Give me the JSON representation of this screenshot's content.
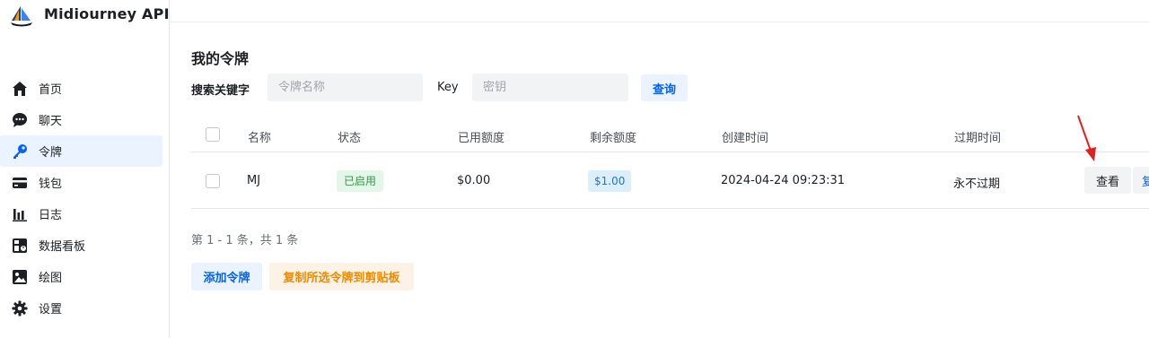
{
  "app": {
    "title": "Midiourney API"
  },
  "sidebar": {
    "items": [
      {
        "label": "首页",
        "icon": "home-icon"
      },
      {
        "label": "聊天",
        "icon": "chat-icon"
      },
      {
        "label": "令牌",
        "icon": "key-icon",
        "active": true
      },
      {
        "label": "钱包",
        "icon": "wallet-icon"
      },
      {
        "label": "日志",
        "icon": "bar-chart-icon"
      },
      {
        "label": "数据看板",
        "icon": "dashboard-icon"
      },
      {
        "label": "绘图",
        "icon": "image-icon"
      },
      {
        "label": "设置",
        "icon": "gear-icon"
      }
    ]
  },
  "page": {
    "title": "我的令牌"
  },
  "search": {
    "label": "搜索关键字",
    "name_placeholder": "令牌名称",
    "key_label": "Key",
    "key_placeholder": "密钥",
    "query_button": "查询"
  },
  "table": {
    "columns": [
      "名称",
      "状态",
      "已用额度",
      "剩余额度",
      "创建时间",
      "过期时间"
    ],
    "rows": [
      {
        "name": "MJ",
        "status": "已启用",
        "used": "$0.00",
        "remaining": "$1.00",
        "created": "2024-04-24 09:23:31",
        "expires": "永不过期",
        "view_button": "查看",
        "copy_button": "复"
      }
    ]
  },
  "pagination": {
    "info": "第 1 - 1 条，共 1 条"
  },
  "actions": {
    "add": "添加令牌",
    "copy_selected": "复制所选令牌到剪贴板"
  },
  "colors": {
    "accent": "#0064fa",
    "active_bg": "#eaf3ff",
    "status_green": "#2e9b4b",
    "warning_orange": "#f08a00",
    "annotation_red": "#e02020"
  }
}
